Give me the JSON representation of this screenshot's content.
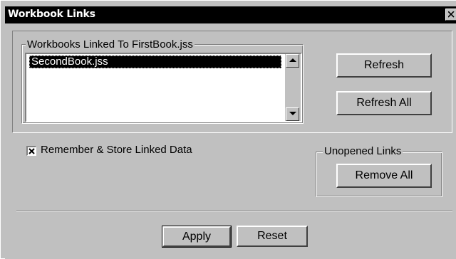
{
  "window": {
    "title": "Workbook Links"
  },
  "linked_group": {
    "label": "Workbooks Linked To FirstBook.jss",
    "items": [
      "SecondBook.jss"
    ],
    "selected_index": 0
  },
  "buttons": {
    "refresh": "Refresh",
    "refresh_all": "Refresh All",
    "remove_all": "Remove All",
    "apply": "Apply",
    "reset": "Reset"
  },
  "remember_option": {
    "label": "Remember & Store Linked Data",
    "checked": true
  },
  "unopened_group": {
    "label": "Unopened Links"
  },
  "icons": {
    "close": "close-icon",
    "scroll_up": "scroll-up-arrow-icon",
    "scroll_down": "scroll-down-arrow-icon",
    "check": "checkbox-x-icon"
  },
  "colors": {
    "face": "#c0c0c0",
    "titlebar": "#000000",
    "selection": "#000000"
  }
}
